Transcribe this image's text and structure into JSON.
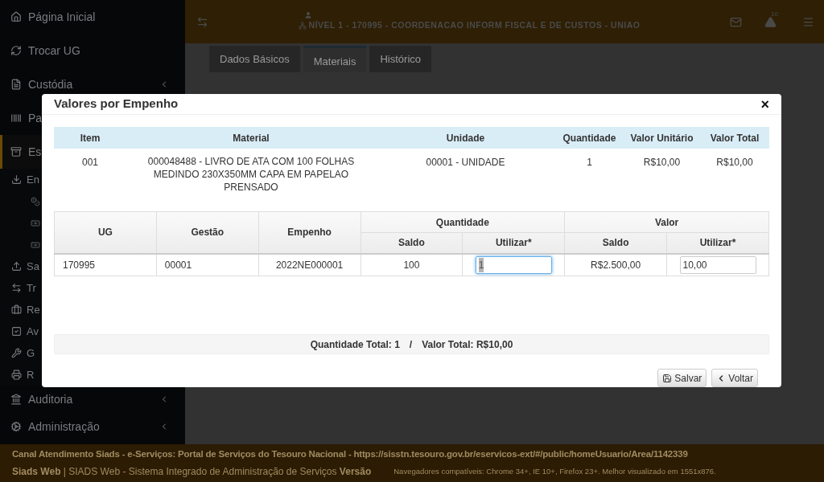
{
  "sidebar": {
    "items": [
      {
        "label": "Página Inicial",
        "selected": false,
        "has_submenu": false
      },
      {
        "label": "Trocar UG",
        "selected": false,
        "has_submenu": false
      },
      {
        "label": "Custódia",
        "selected": false,
        "has_submenu": true
      },
      {
        "label": "Pa",
        "selected": false,
        "has_submenu": false
      },
      {
        "label": "Es",
        "selected": true,
        "has_submenu": false,
        "children": [
          {
            "label": "En",
            "children": [
              {
                "kind": "coins"
              },
              {
                "kind": "banknote"
              },
              {
                "kind": "banknote"
              }
            ]
          },
          {
            "label": "Sa"
          },
          {
            "label": "Tr"
          },
          {
            "label": "Re"
          },
          {
            "label": "Av"
          },
          {
            "label": "G"
          },
          {
            "label": "R"
          }
        ]
      },
      {
        "label": "Auditoria",
        "selected": false,
        "has_submenu": true
      },
      {
        "label": "Administração",
        "selected": false,
        "has_submenu": true
      }
    ]
  },
  "top_bar": {
    "context": "NÍVEL 1 - 170995 - COORDENACAO INFORM FISCAL E DE CUSTOS - UNIAO",
    "alert_count": "10"
  },
  "tabs": [
    {
      "label": "Dados Básicos",
      "selected": false
    },
    {
      "label": "Materiais",
      "selected": true
    },
    {
      "label": "Histórico",
      "selected": false
    }
  ],
  "modal": {
    "title": "Valores por Empenho",
    "close": "×",
    "item_table": {
      "columns": [
        "Item",
        "Material",
        "Unidade",
        "Quantidade",
        "Valor Unitário",
        "Valor Total"
      ],
      "rows": [
        [
          "001",
          "000048488 - LIVRO DE ATA COM 100 FOLHAS MEDINDO 230X350MM CAPA EM PAPELAO PRENSADO",
          "00001 - UNIDADE",
          "1",
          "R$10,00",
          "R$10,00"
        ]
      ]
    },
    "empenho_table": {
      "columns": [
        "UG",
        "Gestão",
        "Empenho"
      ],
      "groups": [
        {
          "label": "Quantidade",
          "columns": [
            "Saldo",
            "Utilizar*"
          ]
        },
        {
          "label": "Valor",
          "columns": [
            "Saldo",
            "Utilizar*"
          ]
        }
      ],
      "rows": [
        {
          "ug": "170995",
          "gestao": "00001",
          "empenho": "2022NE000001",
          "quantidade_saldo": "100",
          "quantidade_utilizar": {
            "value": "1",
            "focused": true
          },
          "valor_saldo": "R$2.500,00",
          "valor_utilizar": {
            "value": "10,00",
            "focused": false
          }
        }
      ]
    },
    "totals": [
      "Quantidade Total: 1",
      "/",
      "Valor Total: R$10,00"
    ],
    "buttons": [
      "Salvar",
      "Voltar"
    ]
  },
  "footer": {
    "line1": "**Canal Atendimento Siads** - e-Serviços: Portal de Serviços do Tesouro Nacional - https://sisstn.tesouro.gov.br/eservicos-ext/#/public/homeUsuario/Area/1142339",
    "line2": "**Siads Web** | SIADS Web - Sistema Integrado de Administração de Serviços  **Versão**",
    "browsers": "Navegadores compatíveis: Chrome 34+, IE 10+, Firefox 23+. Melhor visualizado em 1551x876."
  }
}
